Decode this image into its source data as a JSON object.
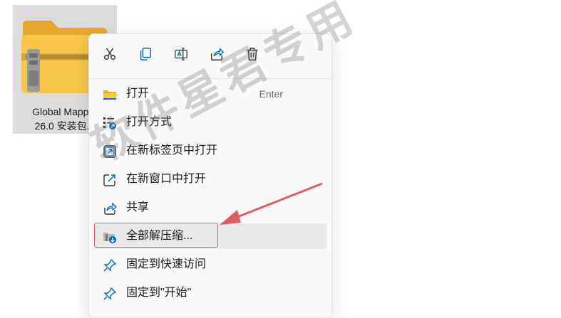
{
  "file": {
    "name_line1": "Global Mapper",
    "name_line2": "26.0 安装包...",
    "icon": "zip-folder-icon"
  },
  "toolbar": {
    "cut_icon": "scissors-icon",
    "copy_icon": "copy-icon",
    "rename_icon": "rename-icon",
    "share_icon": "share-icon",
    "delete_icon": "trash-icon"
  },
  "menu": {
    "items": [
      {
        "label": "打开",
        "shortcut": "Enter",
        "icon": "folder-open-icon"
      },
      {
        "label": "打开方式",
        "icon": "open-with-icon"
      },
      {
        "label": "在新标签页中打开",
        "icon": "new-tab-icon"
      },
      {
        "label": "在新窗口中打开",
        "icon": "new-window-icon"
      },
      {
        "label": "共享",
        "icon": "share-icon"
      },
      {
        "label": "全部解压缩...",
        "icon": "extract-icon"
      },
      {
        "label": "固定到快速访问",
        "icon": "pin-icon"
      },
      {
        "label": "固定到\"开始\"",
        "icon": "pin-icon"
      }
    ]
  },
  "watermark": {
    "text": "软件星君专用"
  },
  "colors": {
    "accent": "#0067c0",
    "annotation": "#e25a64",
    "folder": "#f7c64a"
  }
}
